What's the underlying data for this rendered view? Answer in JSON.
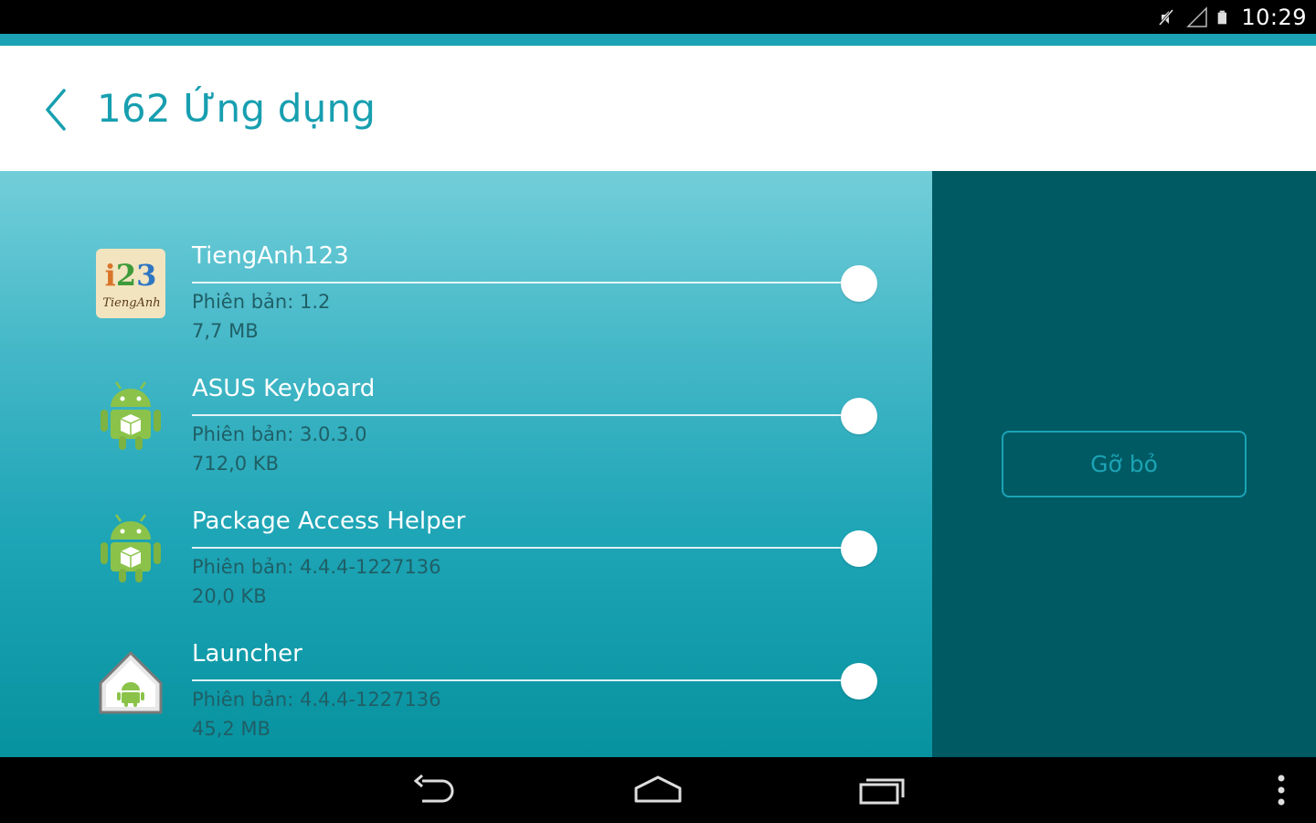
{
  "status_bar": {
    "time": "10:29",
    "icons": [
      "mute-icon",
      "signal-icon",
      "battery-icon"
    ]
  },
  "header": {
    "title": "162 Ứng dụng",
    "back_icon": "chevron-left-icon"
  },
  "apps": [
    {
      "name": "TiengAnh123",
      "version": "Phiên bản: 1.2",
      "size": "7,7 MB",
      "icon": "tienganh123-app-icon",
      "icon_text": "i23",
      "icon_subtext": "TiengAnh",
      "selected": false
    },
    {
      "name": "ASUS Keyboard",
      "version": "Phiên bản: 3.0.3.0",
      "size": "712,0 KB",
      "icon": "android-package-icon",
      "selected": false
    },
    {
      "name": "Package Access Helper",
      "version": "Phiên bản: 4.4.4-1227136",
      "size": "20,0 KB",
      "icon": "android-package-icon",
      "selected": false
    },
    {
      "name": "Launcher",
      "version": "Phiên bản: 4.4.4-1227136",
      "size": "45,2 MB",
      "icon": "launcher-home-icon",
      "selected": false
    }
  ],
  "side_panel": {
    "uninstall_label": "Gỡ bỏ"
  },
  "nav_bar": {
    "buttons": [
      "back-nav-icon",
      "home-nav-icon",
      "recents-nav-icon",
      "overflow-menu-icon"
    ]
  },
  "colors": {
    "accent": "#1ba3b5",
    "side_panel": "#005a63",
    "title": "#179fb0"
  }
}
